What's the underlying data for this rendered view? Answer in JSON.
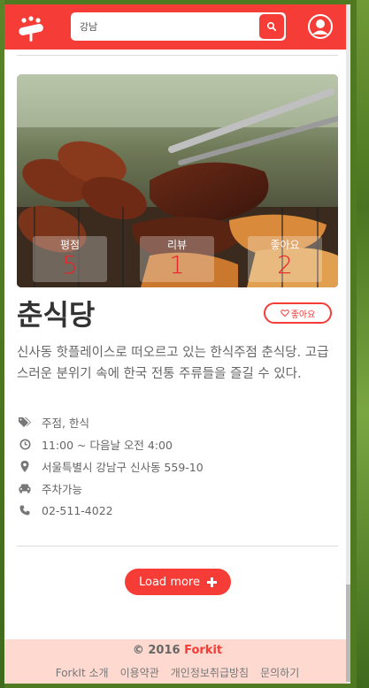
{
  "search": {
    "value": "강남",
    "placeholder": ""
  },
  "restaurant": {
    "stats": [
      {
        "label": "평점",
        "value": "5"
      },
      {
        "label": "리뷰",
        "value": "1"
      },
      {
        "label": "좋아요",
        "value": "2"
      }
    ],
    "name": "춘식당",
    "like_label": "좋아요",
    "description": "신사동 핫플레이스로 떠오르고 있는 한식주점 춘식당. 고급스러운 분위기 속에 한국 전통 주류들을 즐길 수 있다.",
    "info": {
      "category": "주점, 한식",
      "hours": "11:00 ~ 다음날 오전 4:00",
      "address": "서울특별시 강남구 신사동 559-10",
      "parking": "주차가능",
      "phone": "02-511-4022"
    }
  },
  "load_more_label": "Load more",
  "footer": {
    "copyright": "© 2016",
    "brand": "Forkit",
    "links": [
      "ForkIt 소개",
      "이용약관",
      "개인정보취급방침",
      "문의하기"
    ]
  },
  "colors": {
    "accent": "#f53c36",
    "footer_bg": "#fdd9d0"
  }
}
